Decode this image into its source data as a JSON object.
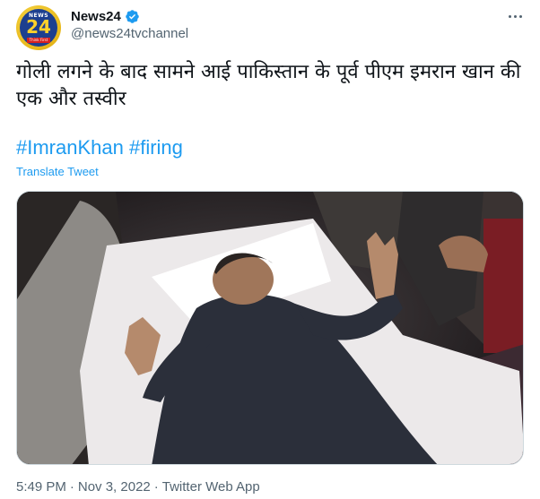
{
  "tweet": {
    "author": {
      "display_name": "News24",
      "handle": "@news24tvchannel",
      "verified": true,
      "avatar": {
        "logo_top": "NEWS",
        "logo_number": "24",
        "logo_tagline": "Think First"
      }
    },
    "text": "गोली लगने के बाद सामने आई पाकिस्तान के पूर्व पीएम इमरान खान की एक और तस्वीर",
    "hashtags": [
      "#ImranKhan",
      "#firing"
    ],
    "translate_label": "Translate Tweet",
    "time": "5:49 PM",
    "separator": "·",
    "date": "Nov 3, 2022",
    "source": "Twitter Web App"
  },
  "icons": {
    "verified": "verified-badge-icon",
    "more": "more-options-icon"
  },
  "colors": {
    "link": "#1d9bf0",
    "secondary_text": "#536471",
    "primary_text": "#0f1419"
  }
}
